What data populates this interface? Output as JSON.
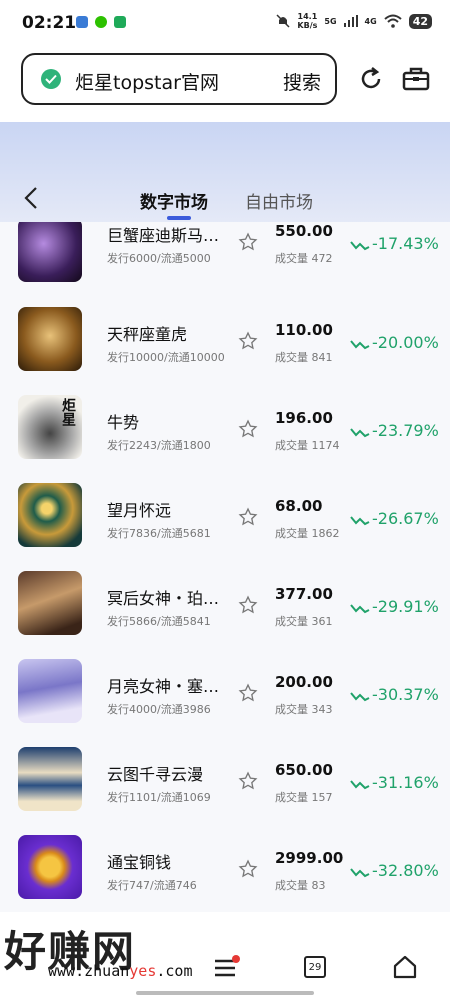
{
  "status_bar": {
    "time": "02:21",
    "speed_top": "14.1",
    "speed_bottom": "KB/s",
    "net1": "5G",
    "net2": "4G",
    "battery": "42"
  },
  "browser": {
    "url_text": "炬星topstar官网",
    "search_label": "搜索",
    "refresh_icon": "refresh-icon",
    "briefcase_icon": "briefcase-icon"
  },
  "header": {
    "tabs": [
      {
        "label": "数字市场",
        "active": true
      },
      {
        "label": "自由市场",
        "active": false
      }
    ]
  },
  "items": [
    {
      "name": "巨蟹座迪斯马…",
      "supply": "发行6000/流通5000",
      "price": "550.00",
      "volume": "成交量 472",
      "change": "-17.43%"
    },
    {
      "name": "天秤座童虎",
      "supply": "发行10000/流通10000",
      "price": "110.00",
      "volume": "成交量 841",
      "change": "-20.00%"
    },
    {
      "name": "牛势",
      "supply": "发行2243/流通1800",
      "price": "196.00",
      "volume": "成交量 1174",
      "change": "-23.79%"
    },
    {
      "name": "望月怀远",
      "supply": "发行7836/流通5681",
      "price": "68.00",
      "volume": "成交量 1862",
      "change": "-26.67%"
    },
    {
      "name": "冥后女神・珀…",
      "supply": "发行5866/流通5841",
      "price": "377.00",
      "volume": "成交量 361",
      "change": "-29.91%"
    },
    {
      "name": "月亮女神・塞…",
      "supply": "发行4000/流通3986",
      "price": "200.00",
      "volume": "成交量 343",
      "change": "-30.37%"
    },
    {
      "name": "云图千寻云漫",
      "supply": "发行1101/流通1069",
      "price": "650.00",
      "volume": "成交量 157",
      "change": "-31.16%"
    },
    {
      "name": "通宝铜钱",
      "supply": "发行747/流通746",
      "price": "2999.00",
      "volume": "成交量 83",
      "change": "-32.80%"
    }
  ],
  "thumb_logo_text": "炬星",
  "bottom_nav": {
    "calendar_day": "29"
  },
  "watermark": {
    "text": "好赚网",
    "url_prefix": "www.zhuan",
    "url_highlight": "yes",
    "url_suffix": ".com"
  },
  "colors": {
    "negative_change": "#20a26a",
    "accent": "#3b5bdb",
    "header_gradient_top": "#c9d5f3"
  }
}
